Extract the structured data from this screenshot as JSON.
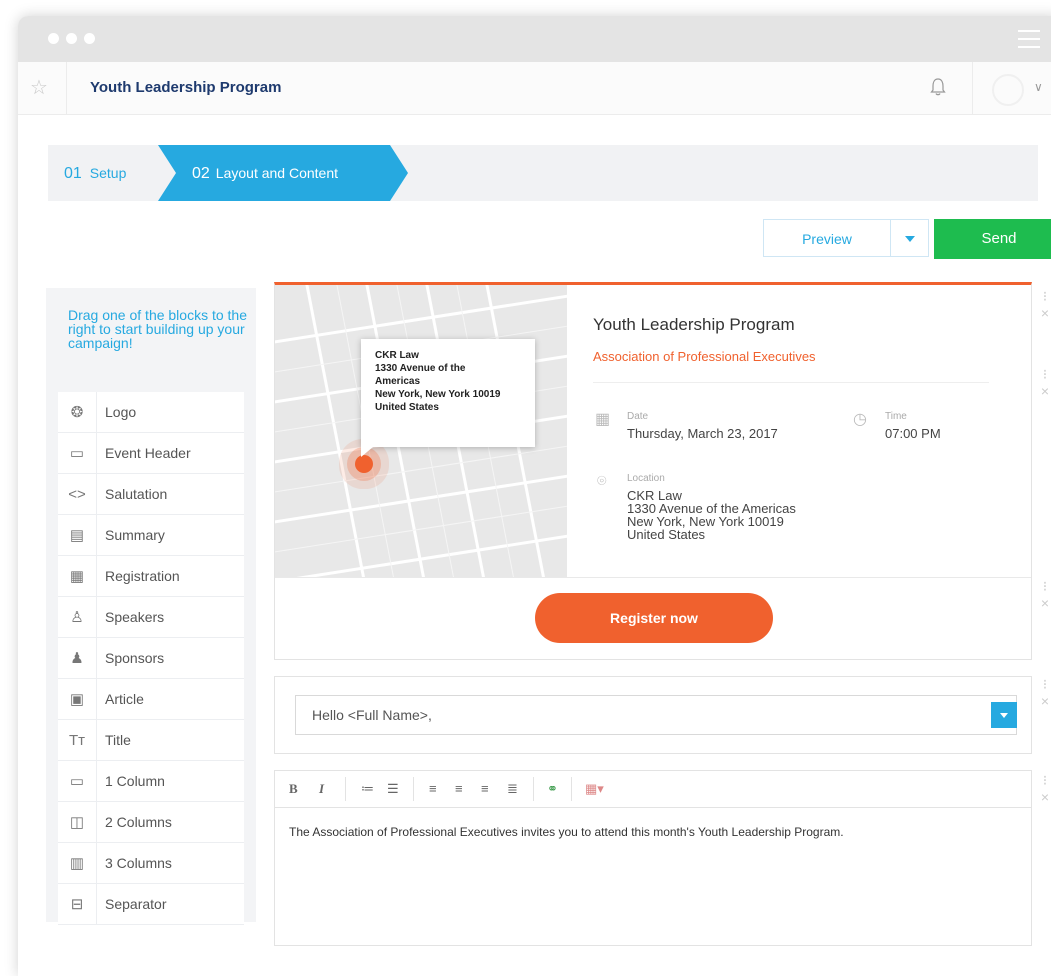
{
  "app": {
    "title": "Youth Leadership Program"
  },
  "steps": [
    {
      "num": "01",
      "label": "Setup"
    },
    {
      "num": "02",
      "label": "Layout and Content"
    }
  ],
  "actions": {
    "preview": "Preview",
    "send": "Send"
  },
  "sidebar": {
    "help": "Drag one of the blocks to the right to start building up your campaign!",
    "blocks": [
      {
        "label": "Logo",
        "icon": "logo-icon"
      },
      {
        "label": "Event Header",
        "icon": "event-header-icon"
      },
      {
        "label": "Salutation",
        "icon": "salutation-icon"
      },
      {
        "label": "Summary",
        "icon": "summary-icon"
      },
      {
        "label": "Registration",
        "icon": "registration-icon"
      },
      {
        "label": "Speakers",
        "icon": "speakers-icon"
      },
      {
        "label": "Sponsors",
        "icon": "sponsors-icon"
      },
      {
        "label": "Article",
        "icon": "article-icon"
      },
      {
        "label": "Title",
        "icon": "title-icon"
      },
      {
        "label": "1 Column",
        "icon": "one-column-icon"
      },
      {
        "label": "2 Columns",
        "icon": "two-columns-icon"
      },
      {
        "label": "3 Columns",
        "icon": "three-columns-icon"
      },
      {
        "label": "Separator",
        "icon": "separator-icon"
      }
    ]
  },
  "event": {
    "title": "Youth Leadership Program",
    "organizer": "Association of Professional Executives",
    "date_label": "Date",
    "date": "Thursday, March 23, 2017",
    "time_label": "Time",
    "time": "07:00 PM",
    "location_label": "Location",
    "location_lines": [
      "CKR Law",
      "1330 Avenue of the Americas",
      "New York, New York 10019",
      "United States"
    ],
    "map_tooltip_lines": [
      "CKR Law",
      "1330 Avenue of the",
      "Americas",
      "New York, New York 10019",
      "United States"
    ],
    "register": "Register now"
  },
  "salutation": {
    "value": "Hello <Full Name>,"
  },
  "editor": {
    "toolbar": [
      "B",
      "I"
    ],
    "body": "The Association of Professional Executives invites you to attend this month's Youth Leadership Program."
  },
  "colors": {
    "accent": "#26a9e0",
    "send": "#1ebc4f",
    "brand": "#f0612e"
  }
}
